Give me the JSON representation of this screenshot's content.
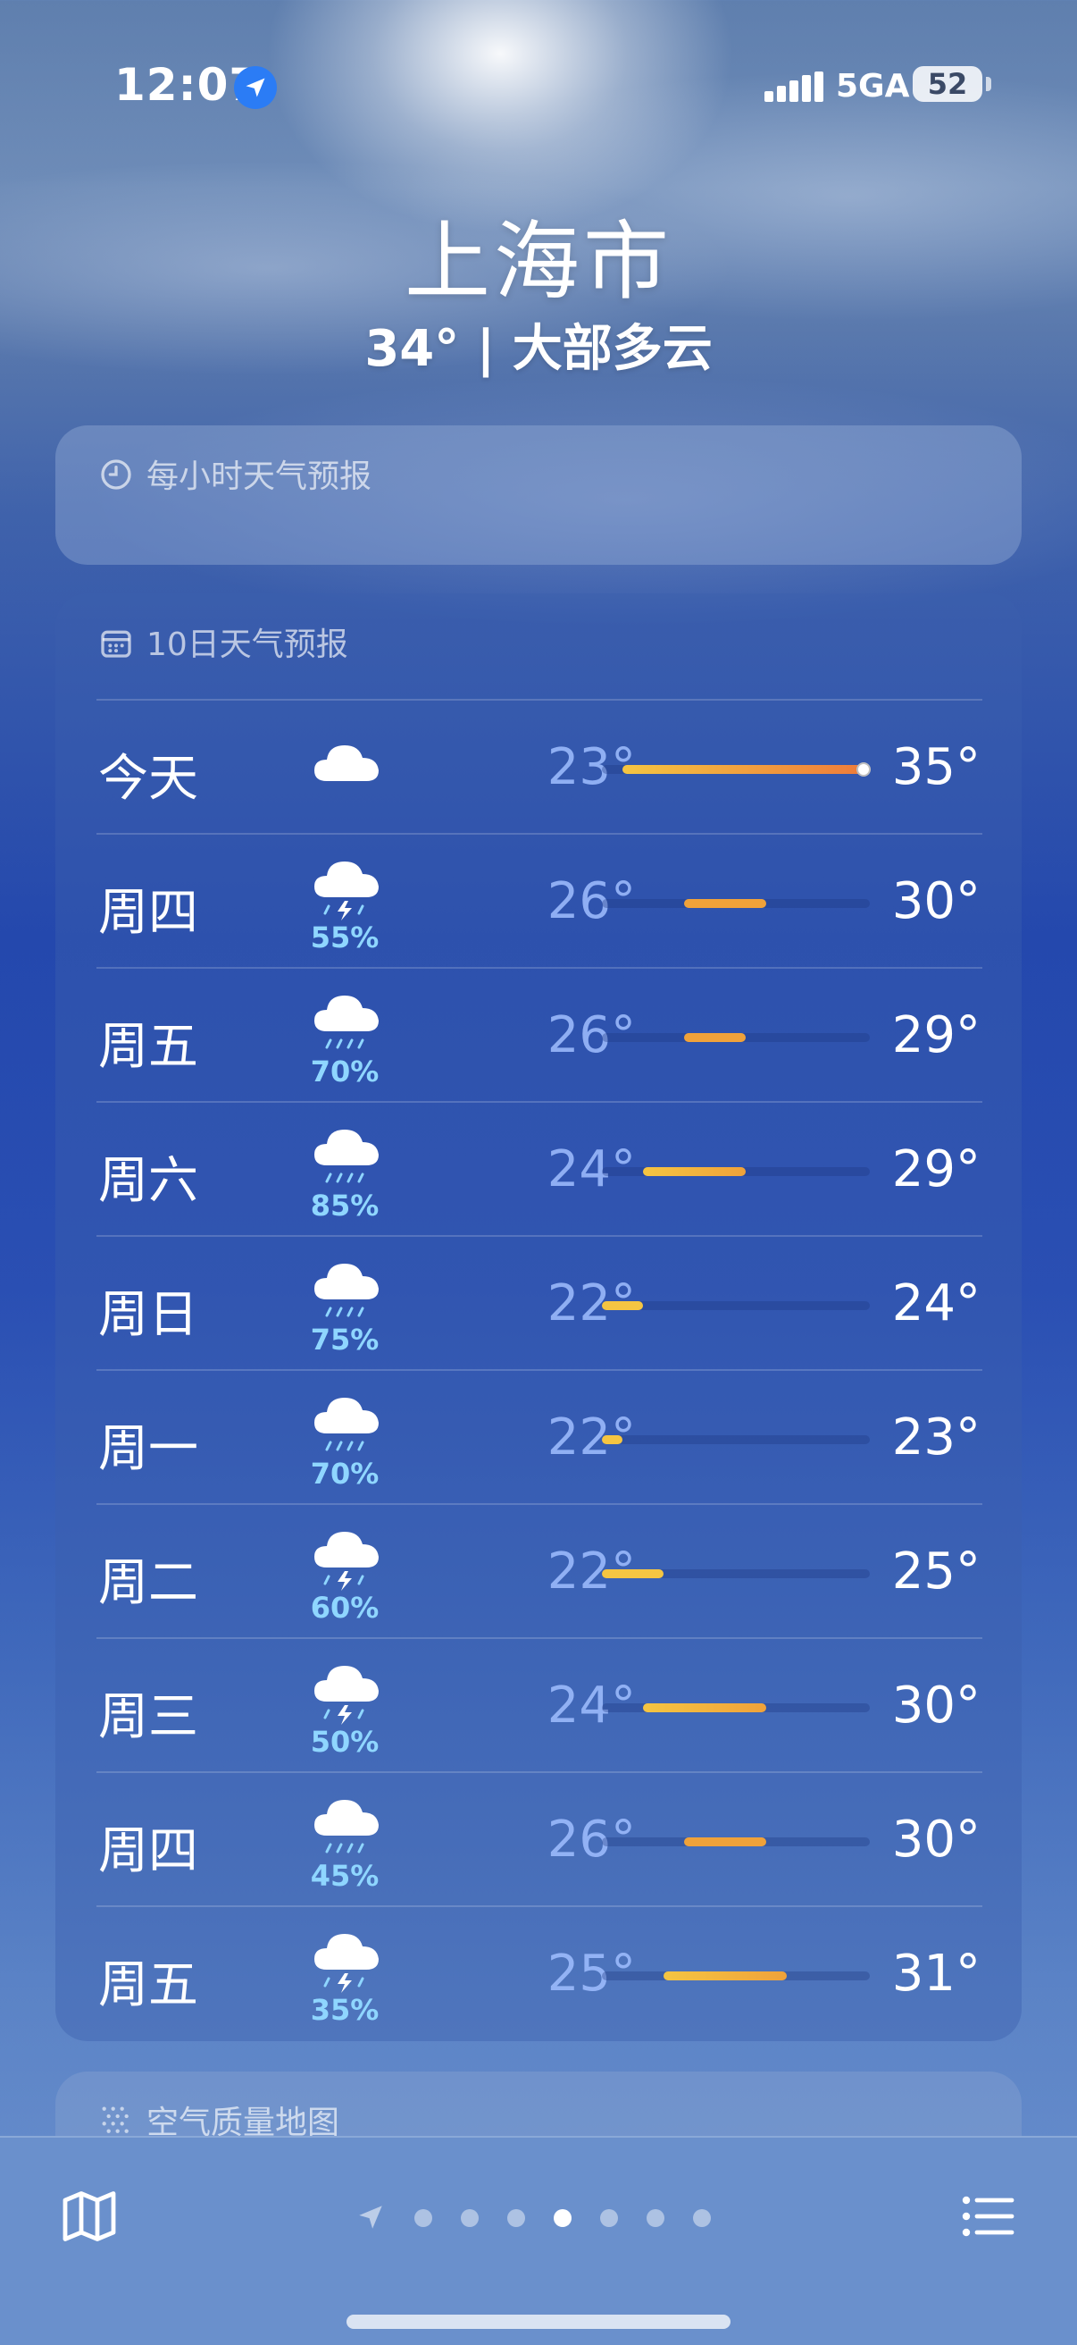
{
  "status_bar": {
    "time": "12:07",
    "network": "5GA",
    "battery": "52"
  },
  "location": {
    "city": "上海市",
    "summary": "34° | 大部多云"
  },
  "hourly_card": {
    "title": "每小时天气预报",
    "icon": "clock-icon"
  },
  "ten_day": {
    "title": "10日天气预报",
    "icon": "calendar-icon",
    "scale": {
      "min": 22,
      "max": 35
    },
    "days": [
      {
        "day": "今天",
        "icon": "cloud-icon",
        "precip": "",
        "low": "23°",
        "high": "35°",
        "low_value": 23,
        "high_value": 35,
        "current_value": 34
      },
      {
        "day": "周四",
        "icon": "thunderstorm-icon",
        "precip": "55%",
        "low": "26°",
        "high": "30°",
        "low_value": 26,
        "high_value": 30
      },
      {
        "day": "周五",
        "icon": "rain-icon",
        "precip": "70%",
        "low": "26°",
        "high": "29°",
        "low_value": 26,
        "high_value": 29
      },
      {
        "day": "周六",
        "icon": "rain-icon",
        "precip": "85%",
        "low": "24°",
        "high": "29°",
        "low_value": 24,
        "high_value": 29
      },
      {
        "day": "周日",
        "icon": "rain-icon",
        "precip": "75%",
        "low": "22°",
        "high": "24°",
        "low_value": 22,
        "high_value": 24
      },
      {
        "day": "周一",
        "icon": "rain-icon",
        "precip": "70%",
        "low": "22°",
        "high": "23°",
        "low_value": 22,
        "high_value": 23
      },
      {
        "day": "周二",
        "icon": "thunderstorm-icon",
        "precip": "60%",
        "low": "22°",
        "high": "25°",
        "low_value": 22,
        "high_value": 25
      },
      {
        "day": "周三",
        "icon": "thunderstorm-icon",
        "precip": "50%",
        "low": "24°",
        "high": "30°",
        "low_value": 24,
        "high_value": 30
      },
      {
        "day": "周四",
        "icon": "rain-icon",
        "precip": "45%",
        "low": "26°",
        "high": "30°",
        "low_value": 26,
        "high_value": 30
      },
      {
        "day": "周五",
        "icon": "thunderstorm-icon",
        "precip": "35%",
        "low": "25°",
        "high": "31°",
        "low_value": 25,
        "high_value": 31
      }
    ]
  },
  "air_quality_card": {
    "title": "空气质量地图",
    "icon": "dots-grid-icon"
  },
  "tab_bar": {
    "map_icon": "map-icon",
    "list_icon": "list-icon",
    "pager": {
      "location_icon": "location-arrow-icon",
      "page_count": 7,
      "active_index": 3
    }
  },
  "colors": {
    "cool": "#f5c542",
    "mid": "#f0a23a",
    "hot": "#ee7a3a",
    "precip": "#8fd6ff"
  }
}
